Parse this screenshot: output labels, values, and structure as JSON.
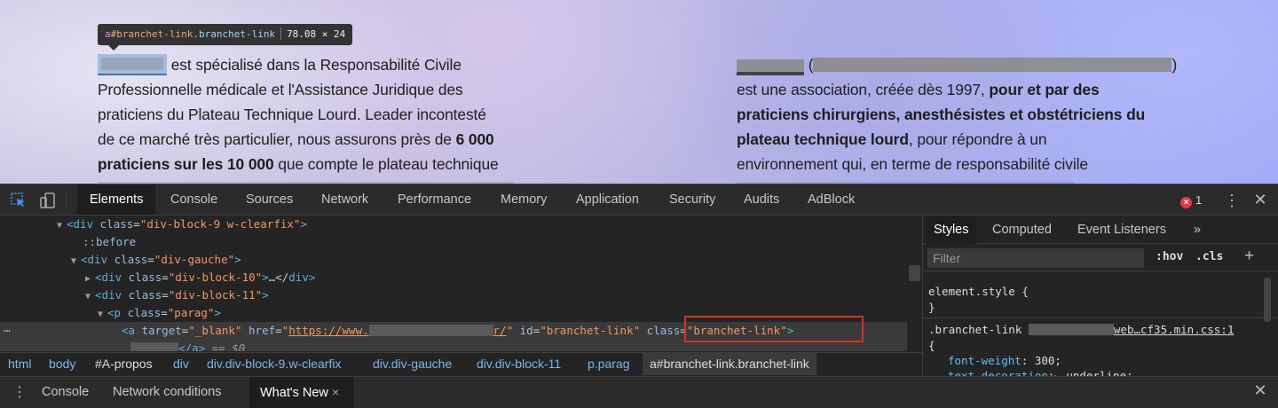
{
  "tooltip": {
    "tag": "a",
    "id": "#branchet-link",
    "class": ".branchet-link",
    "size": "78.08 × 24"
  },
  "page": {
    "left": {
      "line1_rest": " est spécialisé dans la Responsabilité Civile",
      "line2": "Professionnelle médicale et l'Assistance Juridique des",
      "line3": "praticiens du Plateau Technique Lourd. Leader incontesté",
      "line4_a": "de ce marché très particulier, nous assurons près de ",
      "line4_b": "6 000",
      "line5_a": "praticiens sur les  10 000",
      "line5_b": " que compte le plateau technique"
    },
    "right": {
      "line1_open": " (",
      "line1_close": ")",
      "line2_a": "est une association, créée  dès 1997, ",
      "line2_b": "pour et par des",
      "line3": "praticiens chirurgiens, anesthésistes et obstétriciens du",
      "line4_a": "plateau technique lourd",
      "line4_b": ", pour répondre à un",
      "line5": "environnement qui, en terme de responsabilité civile"
    }
  },
  "devtools": {
    "tabs": [
      "Elements",
      "Console",
      "Sources",
      "Network",
      "Performance",
      "Memory",
      "Application",
      "Security",
      "Audits",
      "AdBlock"
    ],
    "error_count": "1",
    "dom": {
      "l1_tag": "div",
      "l1_attr": "class",
      "l1_val": "\"div-block-9 w-clearfix\"",
      "l2": "::before",
      "l3_tag": "div",
      "l3_attr": "class",
      "l3_val": "\"div-gauche\"",
      "l4_tag": "div",
      "l4_attr": "class",
      "l4_val": "\"div-block-10\"",
      "l4_tail": "…</",
      "l4_close_tag": "div",
      "l5_tag": "div",
      "l5_attr": "class",
      "l5_val": "\"div-block-11\"",
      "l6_tag": "p",
      "l6_attr": "class",
      "l6_val": "\"parag\"",
      "l7_tag": "a",
      "l7_target_attr": "target",
      "l7_target_val": "\"_blank\"",
      "l7_href_attr": "href",
      "l7_href_prefix": "\"",
      "l7_href_start": "https://www.",
      "l7_href_end": "r/",
      "l7_href_suffix": "\"",
      "l7_id_attr": "id",
      "l7_id_val": "\"branchet-link\"",
      "l7_class_attr": "class",
      "l7_class_val": "\"branchet-link\"",
      "l8_close_tag": "a",
      "l8_eq": "== $0"
    },
    "breadcrumb": [
      "html",
      "body",
      "#A-propos",
      "div",
      "div.div-block-9.w-clearfix",
      "div.div-gauche",
      "div.div-block-11",
      "p.parag",
      "a#branchet-link.branchet-link"
    ],
    "styles": {
      "tabs": [
        "Styles",
        "Computed",
        "Event Listeners"
      ],
      "more": "»",
      "filter_placeholder": "Filter",
      "hov": ":hov",
      "cls": ".cls",
      "add": "+",
      "element_style_selector": "element.style",
      "open_brace": "{",
      "close_brace": "}",
      "rule_selector": ".branchet-link",
      "rule_source": "web…cf35.min.css:1",
      "prop1_name": "font-weight",
      "prop1_value": "300;",
      "prop2_name": "text-decoration",
      "prop2_value": "underline;"
    },
    "drawer": {
      "tabs": [
        "Console",
        "Network conditions",
        "What's New"
      ],
      "close_tab": "×"
    }
  }
}
